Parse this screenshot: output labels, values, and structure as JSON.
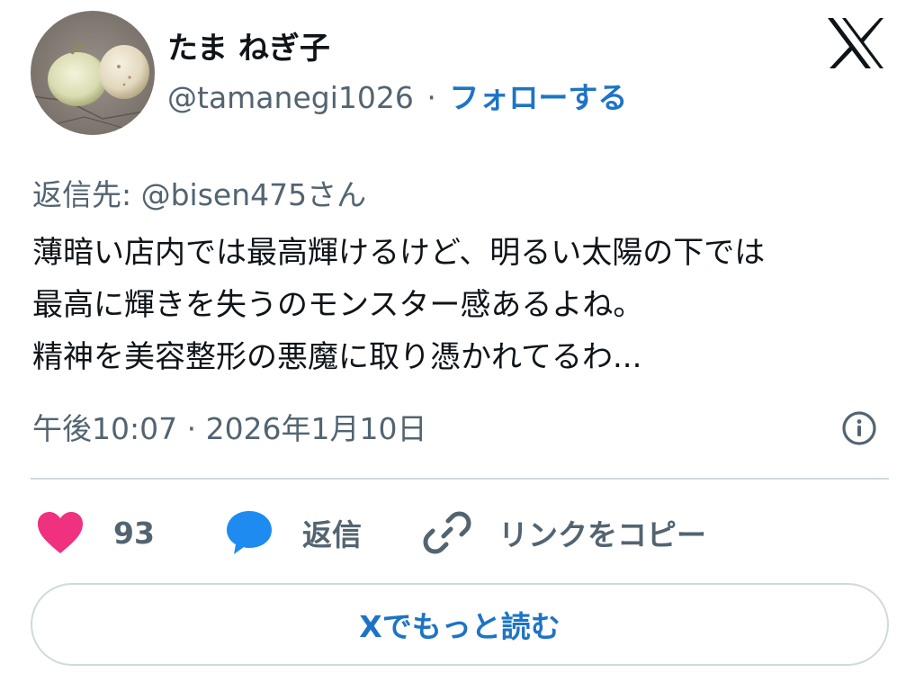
{
  "author": {
    "name": "たま ねぎ子",
    "handle": "@tamanegi1026",
    "separator": "·",
    "follow_label": "フォローする"
  },
  "reply_to": {
    "prefix": "返信先: ",
    "mention": "@bisen475さん"
  },
  "tweet": {
    "lines": [
      "薄暗い店内では最高輝けるけど、明るい太陽の下では",
      "最高に輝きを失うのモンスター感あるよね。",
      "精神を美容整形の悪魔に取り憑かれてるわ..."
    ],
    "timestamp": "午後10:07 · 2026年1月10日"
  },
  "actions": {
    "like_count": "93",
    "reply_label": "返信",
    "copy_link_label": "リンクをコピー"
  },
  "read_more_label": "Xでもっと読む",
  "icons": {
    "logo": "x-logo-icon",
    "info": "info-icon",
    "like": "heart-icon",
    "reply": "speech-bubble-icon",
    "copy": "link-icon"
  },
  "colors": {
    "accent": "#1d74c6",
    "heart": "#f0317f",
    "reply_icon": "#1d8bf0",
    "secondary_text": "#536471",
    "border": "#cfd9de"
  }
}
